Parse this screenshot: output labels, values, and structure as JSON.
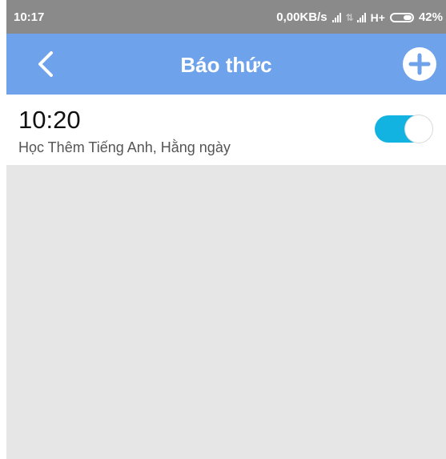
{
  "status_bar": {
    "time": "10:17",
    "speed": "0,00KB/s",
    "network_type": "H+",
    "battery": "42%"
  },
  "app_bar": {
    "title": "Báo thức"
  },
  "alarms": [
    {
      "time": "10:20",
      "label": "Học Thêm Tiếng Anh, Hằng ngày",
      "enabled": true
    }
  ],
  "colors": {
    "status_bar": "#8a8a8a",
    "app_bar": "#6ea2ea",
    "toggle_on": "#12b3e0",
    "background": "#e6e6e6"
  },
  "icons": {
    "back": "chevron-left-icon",
    "add": "plus-circle-icon"
  }
}
